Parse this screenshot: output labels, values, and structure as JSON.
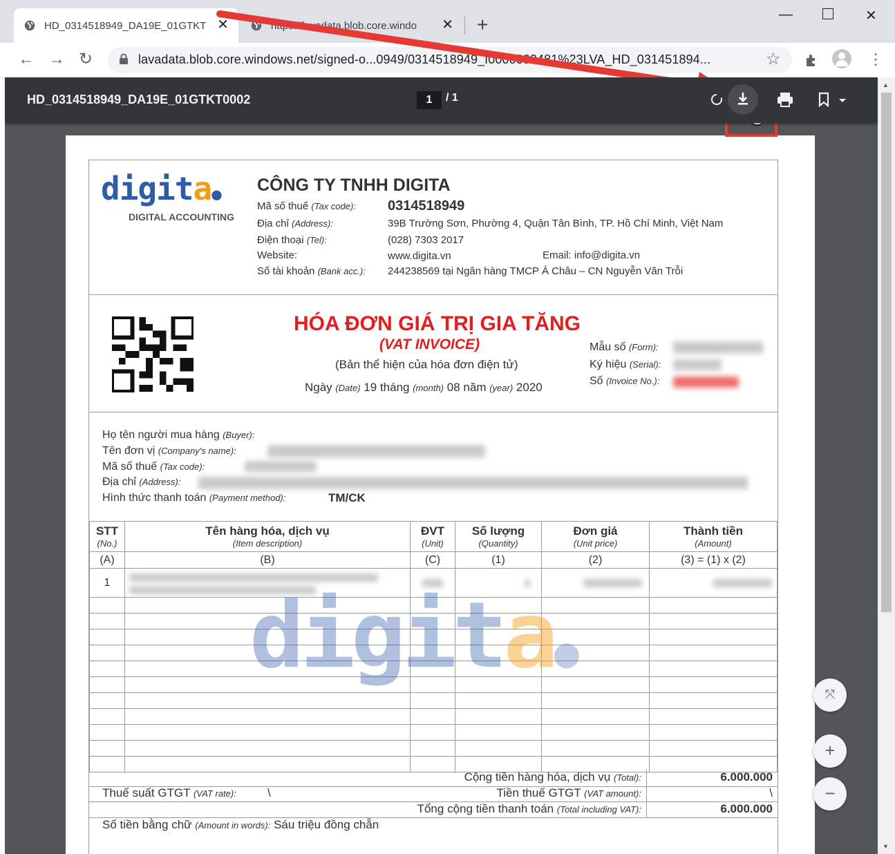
{
  "browser": {
    "tabs": [
      {
        "title": "HD_0314518949_DA19E_01GTKT",
        "active": true
      },
      {
        "title": "https://lavadata.blob.core.windo",
        "active": false
      }
    ],
    "url": "lavadata.blob.core.windows.net/signed-o...0949/0314518949_I0000000481%23LVA_HD_031451894..."
  },
  "pdf": {
    "file_title": "HD_0314518949_DA19E_01GTKT0002",
    "page_current": "1",
    "page_total": "/ 1"
  },
  "invoice": {
    "logo_word": "digita",
    "logo_accent": "a.",
    "logo_sub": "DIGITAL ACCOUNTING",
    "company_name": "CÔNG TY TNHH DIGITA",
    "tax_label": "Mã số thuế",
    "tax_label_en": "(Tax code):",
    "tax_code": "0314518949",
    "address_label": "Địa chỉ",
    "address_label_en": "(Address):",
    "address": "39B Trường Sơn, Phường 4, Quận Tân Bình, TP. Hồ Chí Minh, Việt Nam",
    "tel_label": "Điện thoại",
    "tel_label_en": "(Tel):",
    "tel": "(028) 7303 2017",
    "website_label": "Website:",
    "website": "www.digita.vn",
    "email": "Email: info@digita.vn",
    "bank_label": "Số tài khoản",
    "bank_label_en": "(Bank acc.):",
    "bank": "244238569 tại Ngân hàng TMCP Á Châu – CN Nguyễn Văn Trỗi",
    "title": "HÓA ĐƠN GIÁ TRỊ GIA TĂNG",
    "title_en": "(VAT INVOICE)",
    "subtitle": "(Bản thể hiện của hóa đơn điện tử)",
    "date_line": {
      "ngay": "Ngày",
      "date_en": "(Date)",
      "day": "19",
      "thang": "tháng",
      "month_en": "(month)",
      "month": "08",
      "nam": "năm",
      "year_en": "(year)",
      "year": "2020"
    },
    "form_label": "Mẫu số",
    "form_label_en": "(Form):",
    "serial_label": "Ký hiệu",
    "serial_label_en": "(Serial):",
    "invno_label": "Số",
    "invno_label_en": "(Invoice No.):",
    "buyer_label": "Họ tên người mua hàng",
    "buyer_label_en": "(Buyer):",
    "company_label": "Tên đơn vị",
    "company_label_en": "(Company's name):",
    "btax_label": "Mã số thuế",
    "btax_label_en": "(Tax code):",
    "baddr_label": "Địa chỉ",
    "baddr_label_en": "(Address):",
    "pay_label": "Hình thức thanh toán",
    "pay_label_en": "(Payment method):",
    "pay_value": "TM/CK",
    "columns": [
      {
        "vi": "STT",
        "en": "(No.)",
        "code": "(A)"
      },
      {
        "vi": "Tên hàng hóa, dịch vụ",
        "en": "(Item description)",
        "code": "(B)"
      },
      {
        "vi": "ĐVT",
        "en": "(Unit)",
        "code": "(C)"
      },
      {
        "vi": "Số lượng",
        "en": "(Quantity)",
        "code": "(1)"
      },
      {
        "vi": "Đơn giá",
        "en": "(Unit price)",
        "code": "(2)"
      },
      {
        "vi": "Thành tiền",
        "en": "(Amount)",
        "code": "(3) = (1) x (2)"
      }
    ],
    "row1_no": "1",
    "total_label": "Cộng tiền hàng hóa, dịch vụ",
    "total_label_en": "(Total):",
    "total": "6.000.000",
    "vat_rate_label": "Thuế suất GTGT",
    "vat_rate_label_en": "(VAT rate):",
    "vat_rate": "\\",
    "vat_amount_label": "Tiền thuế GTGT",
    "vat_amount_label_en": "(VAT amount):",
    "vat_amount": "\\",
    "grand_label": "Tổng cộng tiền thanh toán",
    "grand_label_en": "(Total including VAT):",
    "grand_total": "6.000.000",
    "words_label": "Số tiền bằng chữ",
    "words_label_en": "(Amount in words):",
    "words": "Sáu triệu đồng chẵn"
  },
  "colors": {
    "accent_red": "#e02020",
    "logo_blue": "#2d5da8",
    "logo_orange": "#f39c12",
    "annotation_red": "#e53935"
  }
}
